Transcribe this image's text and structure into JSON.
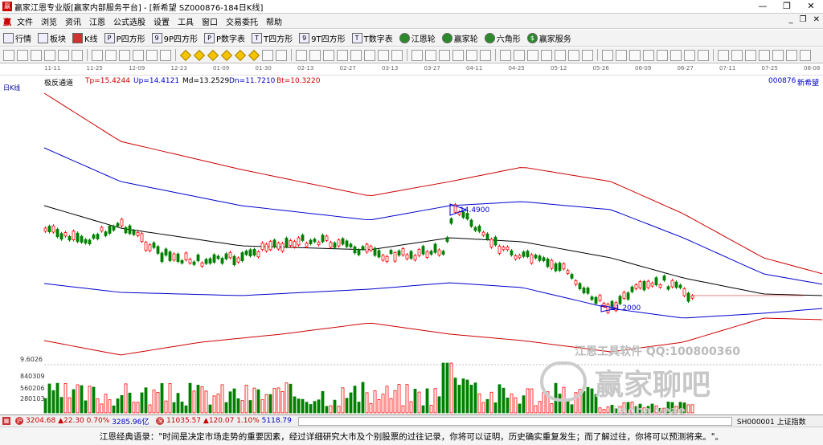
{
  "window": {
    "title": "赢家江恩专业版[赢家内部服务平台] - [新希望  SZ000876-184日K线]",
    "controls": [
      "—",
      "❐",
      "✕"
    ]
  },
  "menu": {
    "logo": "赢",
    "items": [
      "文件",
      "浏览",
      "资讯",
      "江恩",
      "公式选股",
      "设置",
      "工具",
      "窗口",
      "交易委托",
      "帮助"
    ],
    "mdi": [
      "_",
      "❐",
      "✕"
    ]
  },
  "toolbar1": [
    "行情",
    "板块",
    "K线",
    "P四方形",
    "9P四方形",
    "P数字表",
    "T四方形",
    "9T四方形",
    "T数字表",
    "江恩轮",
    "赢家轮",
    "六角形",
    "赢家服务"
  ],
  "dates": [
    "11-11",
    "11-25",
    "12-09",
    "12-23",
    "01-09",
    "01-30",
    "02-13",
    "02-27",
    "03-13",
    "03-27",
    "04-11",
    "04-25",
    "05-12",
    "05-26",
    "06-09",
    "06-27",
    "07-11",
    "07-25",
    "08-08"
  ],
  "chart_header": {
    "name": "极反通道",
    "tp": "Tp=15.4244",
    "up": "Up=14.4121",
    "md": "Md=13.2529",
    "dn": "Dn=11.7210",
    "bt": "Bt=10.3220",
    "code": "000876",
    "stock": "新希望"
  },
  "period_label": "日K线",
  "annotations": {
    "high": "14.4900",
    "low": "11.2000"
  },
  "volume_axis": [
    "9.6026",
    "840309",
    "560206",
    "280103"
  ],
  "watermark": {
    "line1": "江恩工具软件  QQ:100800360",
    "line2": "赢家聊吧",
    "line3": "jiaoba.yeae"
  },
  "status": {
    "sh": "3204.68",
    "sh_chg": "▲22.30",
    "sh_pct": "0.70%",
    "sh_amt": "3285.96亿",
    "sz": "11035.57",
    "sz_chg": "▲120.07",
    "sz_pct": "1.10%",
    "sz_amt": "5118.79",
    "index": "SH000001 上证指数"
  },
  "quote": "江恩经典语录：\"时间是决定市场走势的重要因素，经过详细研究大市及个别股票的过往记录，你将可以证明，历史确实重复发生；而了解过往，你将可以预测将来。\"。",
  "colors": {
    "up": "#ff0000",
    "down": "#008000",
    "outer": "#cc0000",
    "inner": "#0000cc",
    "mid": "#000000"
  }
}
